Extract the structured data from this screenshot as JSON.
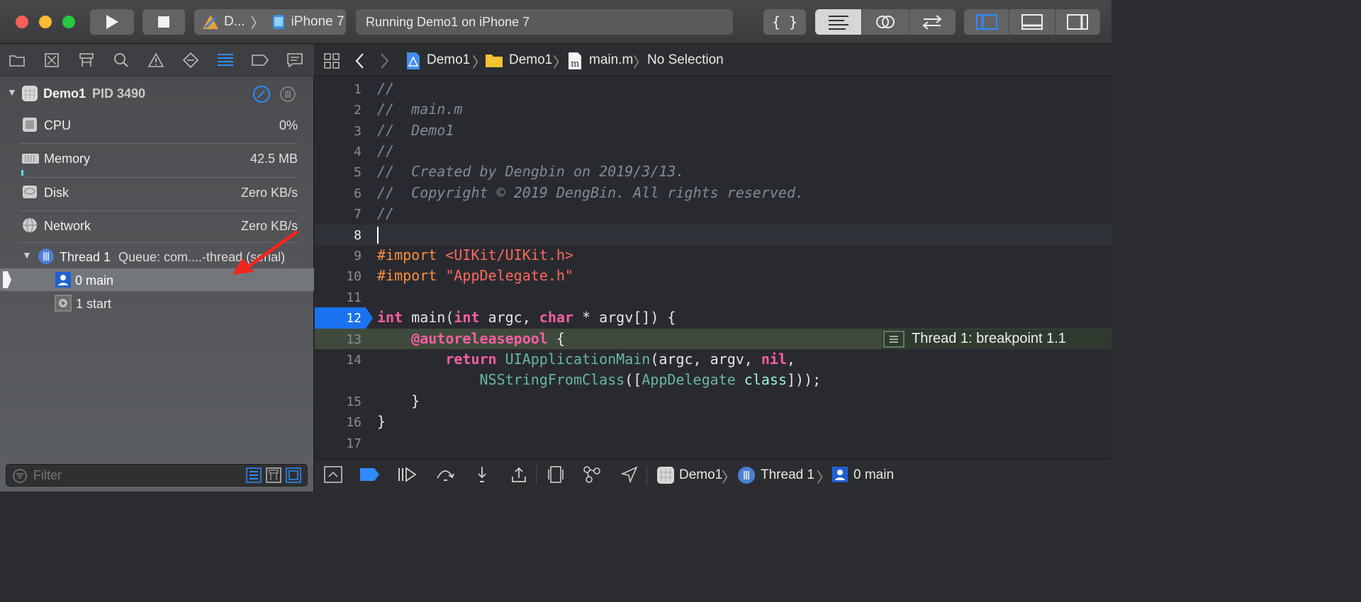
{
  "toolbar": {
    "scheme_name": "D...",
    "destination": "iPhone 7",
    "activity_status": "Running Demo1 on iPhone 7",
    "editor_mode_icons": [
      "braces-icon",
      "lines-icon",
      "circles-icon",
      "arrows-icon"
    ],
    "layout_icons": [
      "left-panel-icon",
      "bottom-panel-icon",
      "right-panel-icon"
    ]
  },
  "navigator": {
    "tab_icons": [
      "folder-icon",
      "symbol-icon",
      "hierarchy-icon",
      "search-icon",
      "warning-icon",
      "test-icon",
      "debug-icon",
      "breakpoint-icon",
      "report-icon"
    ],
    "process": {
      "name": "Demo1",
      "pid": "PID 3490"
    },
    "gauges": [
      {
        "label": "CPU",
        "value": "0%",
        "icon": "cpu-icon"
      },
      {
        "label": "Memory",
        "value": "42.5 MB",
        "icon": "memory-icon"
      },
      {
        "label": "Disk",
        "value": "Zero KB/s",
        "icon": "disk-icon"
      },
      {
        "label": "Network",
        "value": "Zero KB/s",
        "icon": "network-icon"
      }
    ],
    "thread": {
      "name": "Thread 1",
      "queue": "Queue: com....-thread (serial)"
    },
    "frames": [
      {
        "label": "0 main",
        "icon": "user-frame-icon"
      },
      {
        "label": "1 start",
        "icon": "system-frame-icon"
      }
    ],
    "filter_placeholder": "Filter"
  },
  "jumpbar": {
    "crumbs": [
      "Demo1",
      "Demo1",
      "main.m",
      "No Selection"
    ]
  },
  "editor": {
    "line_numbers": [
      "1",
      "2",
      "3",
      "4",
      "5",
      "6",
      "7",
      "8",
      "9",
      "10",
      "11",
      "12",
      "13",
      "14",
      "",
      "15",
      "16",
      "17"
    ],
    "lines": {
      "l1": "//",
      "l2": "//  main.m",
      "l3": "//  Demo1",
      "l4": "//",
      "l5": "//  Created by Dengbin on 2019/3/13.",
      "l6": "//  Copyright © 2019 DengBin. All rights reserved.",
      "l7": "//",
      "l9_kw": "#import",
      "l9_str": "<UIKit/UIKit.h>",
      "l10_kw": "#import",
      "l10_str": "\"AppDelegate.h\"",
      "l12_int1": "int",
      "l12_main": " main(",
      "l12_int2": "int",
      "l12_argc": " argc, ",
      "l12_char": "char",
      "l12_rest": " * argv[]) {",
      "l13_kw": "@autoreleasepool",
      "l13_rest": " {",
      "l14_kw": "return",
      "l14_fn": "UIApplicationMain",
      "l14_args": "(argc, argv, ",
      "l14_nil": "nil",
      "l14_end": ",",
      "l14b_fn": "NSStringFromClass",
      "l14b_open": "([",
      "l14b_cls": "AppDelegate",
      "l14b_class": "class",
      "l14b_close": "]));",
      "l15": "}",
      "l16": "}"
    },
    "breakpoint_line": "12",
    "annotation": "Thread 1: breakpoint 1.1"
  },
  "debugbar": {
    "crumbs": [
      "Demo1",
      "Thread 1",
      "0 main"
    ]
  },
  "colors": {
    "breakpoint_blue": "#1a72f0",
    "current_line_green": "#3e4a3c",
    "annotation_bg": "#2f3b2e"
  }
}
